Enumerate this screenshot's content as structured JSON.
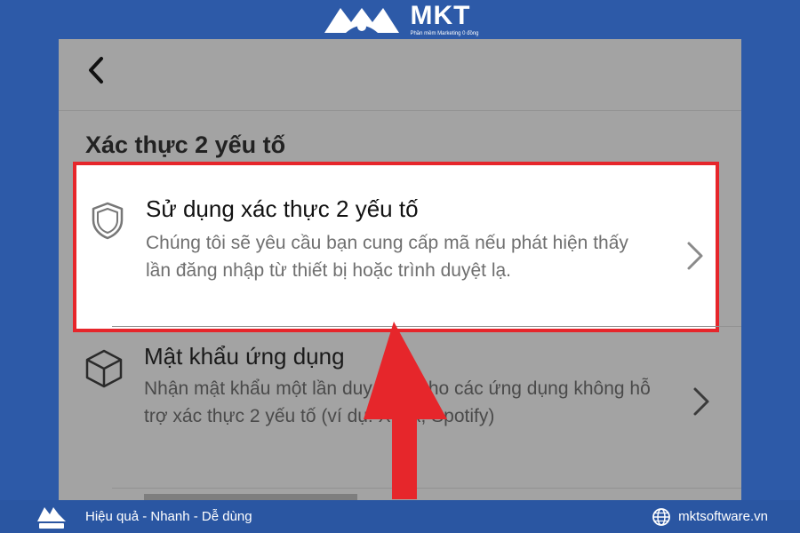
{
  "brand": {
    "name": "MKT",
    "tagline": "Phần mềm Marketing 0 đồng"
  },
  "screen": {
    "back_icon": "chevron-left-icon",
    "section_title": "Xác thực 2 yếu tố",
    "rows": [
      {
        "icon": "shield-icon",
        "title": "Sử dụng xác thực 2 yếu tố",
        "description": "Chúng tôi sẽ yêu cầu bạn cung cấp mã nếu phát hiện thấy lần đăng nhập từ thiết bị hoặc trình duyệt lạ.",
        "highlighted": true
      },
      {
        "icon": "cube-icon",
        "title": "Mật khẩu ứng dụng",
        "description": "Nhận mật khẩu một lần duy nhất cho các ứng dụng không hỗ trợ xác thực 2 yếu tố (ví dụ: Xbox, Spotify)",
        "highlighted": false
      }
    ]
  },
  "annotation": {
    "arrow_icon": "red-arrow-up-icon",
    "highlight_color": "#e6262b"
  },
  "footer": {
    "slogan": "Hiệu quả - Nhanh - Dễ dùng",
    "website": "mktsoftware.vn",
    "globe_icon": "globe-icon"
  },
  "colors": {
    "background": "#2d5aa8",
    "screen_overlay": "#a3a3a3",
    "highlight_border": "#e6262b"
  }
}
